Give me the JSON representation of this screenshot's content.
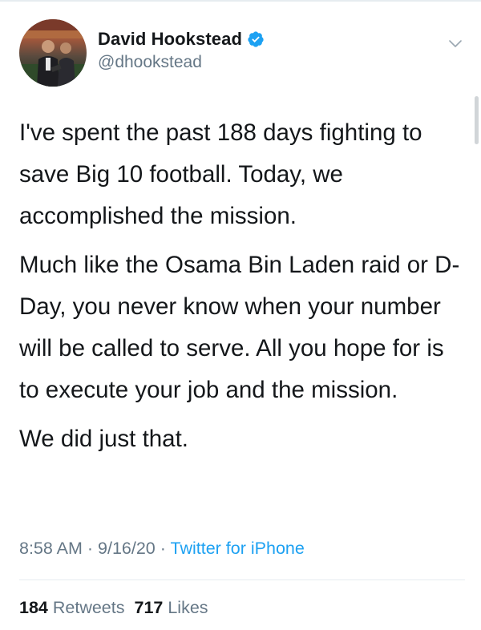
{
  "user": {
    "display_name": "David Hookstead",
    "handle": "@dhookstead",
    "verified": true,
    "verified_color": "#1da1f2"
  },
  "tweet": {
    "paragraphs": [
      "I've spent the past 188 days fighting to save Big 10 football. Today, we accomplished the mission.",
      "Much like the Osama Bin Laden raid or D-Day, you never know when your number will be called to serve. All you hope for is to execute your job and the mission.",
      "We did just that."
    ],
    "time": "8:58 AM",
    "date": "9/16/20",
    "separator": "·",
    "source": "Twitter for iPhone"
  },
  "stats": {
    "retweets_count": "184",
    "retweets_label": "Retweets",
    "likes_count": "717",
    "likes_label": "Likes"
  },
  "icons": {
    "verified": "verified-badge-icon",
    "chevron": "chevron-down-icon"
  },
  "colors": {
    "text": "#14171a",
    "secondary": "#657786",
    "link": "#1da1f2"
  }
}
